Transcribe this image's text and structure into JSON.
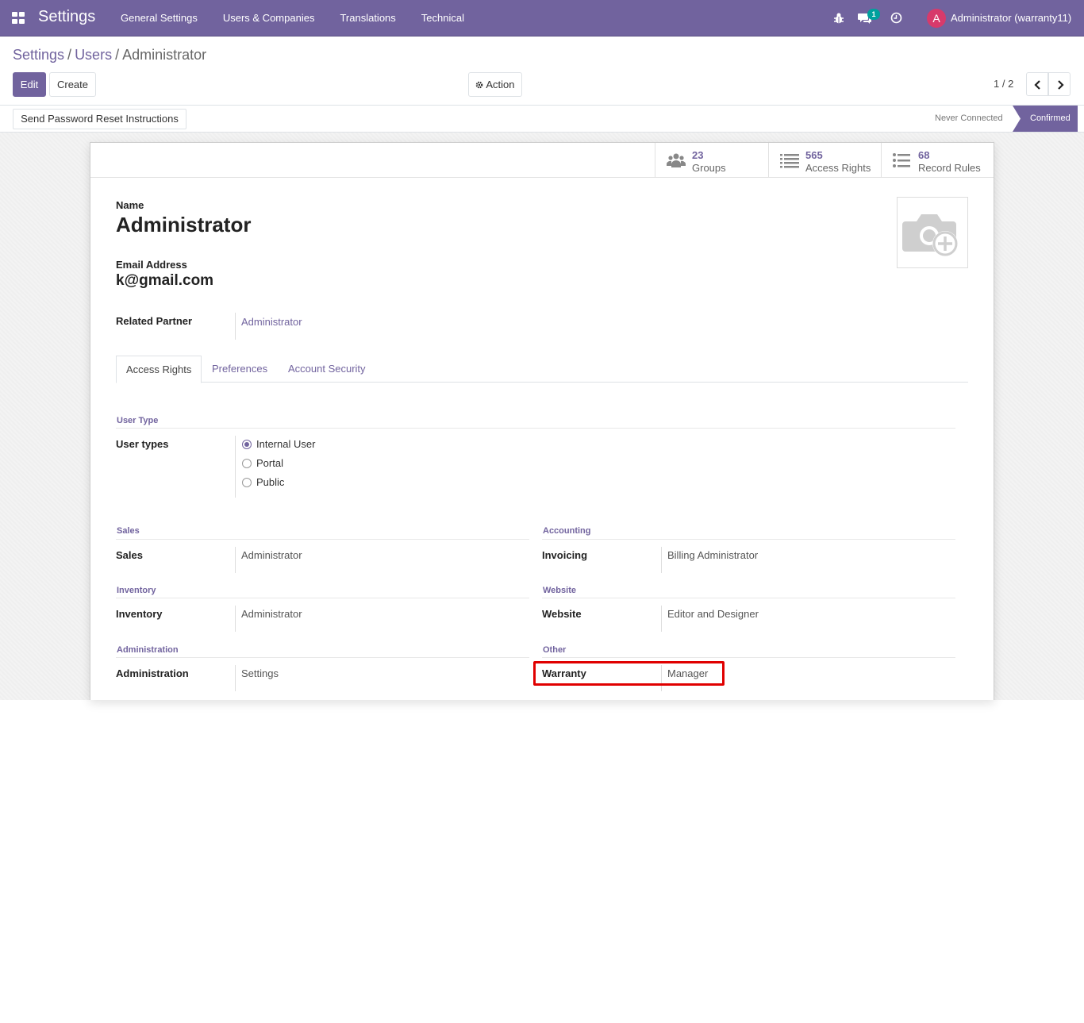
{
  "topbar": {
    "app_title": "Settings",
    "menu": [
      "General Settings",
      "Users & Companies",
      "Translations",
      "Technical"
    ],
    "chat_count": "1",
    "avatar_letter": "A",
    "user_name": "Administrator (warranty11)"
  },
  "breadcrumb": {
    "settings": "Settings",
    "users": "Users",
    "current": "Administrator"
  },
  "controls": {
    "edit": "Edit",
    "create": "Create",
    "action": "Action",
    "pager": "1 / 2"
  },
  "statusbar": {
    "reset_button": "Send Password Reset Instructions",
    "never_connected": "Never Connected",
    "confirmed": "Confirmed"
  },
  "smart_buttons": [
    {
      "value": "23",
      "label": "Groups",
      "icon": "users-icon"
    },
    {
      "value": "565",
      "label": "Access Rights",
      "icon": "list-icon"
    },
    {
      "value": "68",
      "label": "Record Rules",
      "icon": "list-icon"
    }
  ],
  "form": {
    "name_label": "Name",
    "name": "Administrator",
    "email_label": "Email Address",
    "email": "k@gmail.com",
    "related_partner_label": "Related Partner",
    "related_partner": "Administrator"
  },
  "tabs": [
    "Access Rights",
    "Preferences",
    "Account Security"
  ],
  "access": {
    "user_type_group": "User Type",
    "user_types_label": "User types",
    "user_types": [
      "Internal User",
      "Portal",
      "Public"
    ],
    "selected_user_type": "Internal User",
    "groups": [
      {
        "title": "Sales",
        "label": "Sales",
        "value": "Administrator"
      },
      {
        "title": "Accounting",
        "label": "Invoicing",
        "value": "Billing Administrator"
      },
      {
        "title": "Inventory",
        "label": "Inventory",
        "value": "Administrator"
      },
      {
        "title": "Website",
        "label": "Website",
        "value": "Editor and Designer"
      },
      {
        "title": "Administration",
        "label": "Administration",
        "value": "Settings"
      },
      {
        "title": "Other",
        "label": "Warranty",
        "value": "Manager"
      }
    ]
  },
  "colors": {
    "brand": "#71639e",
    "highlight": "#e00000",
    "badge": "#00a09d"
  }
}
